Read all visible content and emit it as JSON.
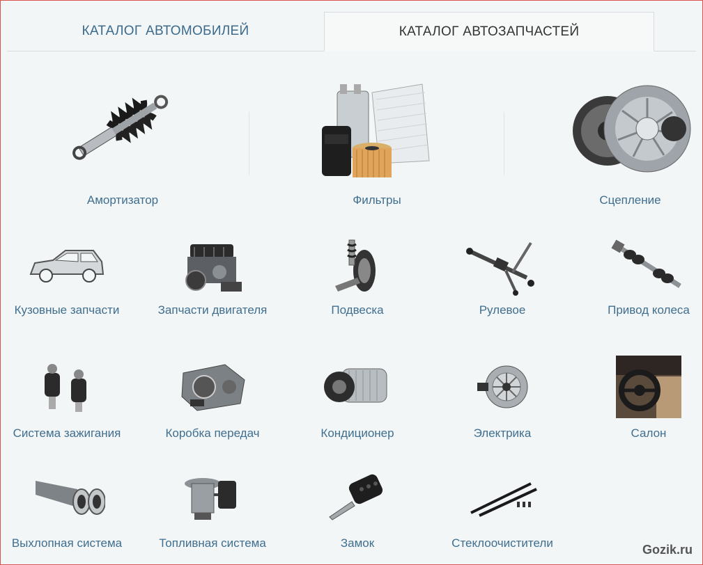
{
  "tabs": {
    "cars": "КАТАЛОГ АВТОМОБИЛЕЙ",
    "parts": "КАТАЛОГ АВТОЗАПЧАСТЕЙ"
  },
  "featured": [
    {
      "label": "Амортизатор",
      "icon": "shock-absorber-icon"
    },
    {
      "label": "Фильтры",
      "icon": "filters-icon"
    },
    {
      "label": "Сцепление",
      "icon": "clutch-icon"
    }
  ],
  "row2": [
    {
      "label": "Кузовные запчасти",
      "icon": "car-body-icon"
    },
    {
      "label": "Запчасти двигателя",
      "icon": "engine-icon"
    },
    {
      "label": "Подвеска",
      "icon": "suspension-icon"
    },
    {
      "label": "Рулевое",
      "icon": "steering-rack-icon"
    },
    {
      "label": "Привод колеса",
      "icon": "drive-shaft-icon"
    }
  ],
  "row3": [
    {
      "label": "Система зажигания",
      "icon": "ignition-coil-icon"
    },
    {
      "label": "Коробка передач",
      "icon": "gearbox-icon"
    },
    {
      "label": "Кондиционер",
      "icon": "ac-compressor-icon"
    },
    {
      "label": "Электрика",
      "icon": "alternator-icon"
    },
    {
      "label": "Салон",
      "icon": "car-interior-icon"
    }
  ],
  "row4": [
    {
      "label": "Выхлопная система",
      "icon": "exhaust-icon"
    },
    {
      "label": "Топливная система",
      "icon": "fuel-pump-icon"
    },
    {
      "label": "Замок",
      "icon": "car-key-icon"
    },
    {
      "label": "Стеклоочистители",
      "icon": "wiper-blades-icon"
    }
  ],
  "watermark": "Gozik.ru"
}
